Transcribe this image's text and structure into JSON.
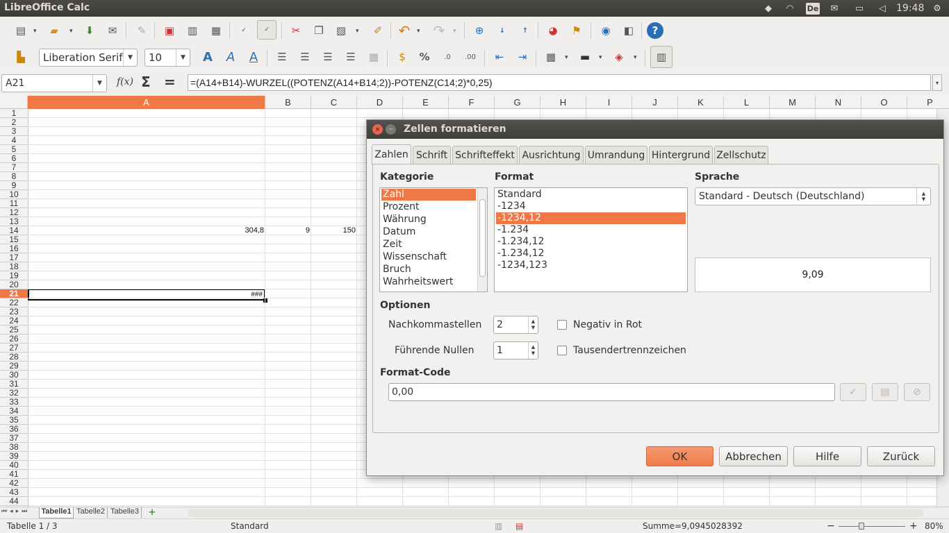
{
  "topbar": {
    "app_title": "LibreOffice Calc",
    "keyboard_layout": "De",
    "clock": "19:48"
  },
  "format_toolbar": {
    "font_name": "Liberation Serif",
    "font_size": "10"
  },
  "formula_bar": {
    "name_box": "A21",
    "fx": "f(x)",
    "sigma": "Σ",
    "equals": "=",
    "formula": "=(A14+B14)-WURZEL((POTENZ(A14+B14;2))-POTENZ(C14;2)*0,25)"
  },
  "sheet": {
    "columns": [
      "A",
      "B",
      "C",
      "D",
      "E",
      "F",
      "G",
      "H",
      "I",
      "J",
      "K",
      "L",
      "M",
      "N",
      "O",
      "P"
    ],
    "rows": [
      "1",
      "2",
      "3",
      "4",
      "5",
      "6",
      "7",
      "8",
      "9",
      "10",
      "11",
      "12",
      "13",
      "14",
      "15",
      "16",
      "17",
      "18",
      "19",
      "20",
      "21",
      "22",
      "23",
      "24",
      "25",
      "26",
      "27",
      "28",
      "29",
      "30",
      "31",
      "32",
      "33",
      "34",
      "35",
      "36",
      "37",
      "38",
      "39",
      "40",
      "41",
      "42",
      "43",
      "44"
    ],
    "cells": {
      "A14": "304,8",
      "B14": "9",
      "C14": "150",
      "A21": "###"
    },
    "selected_cell": "A21"
  },
  "sheet_tabs": [
    "Tabelle1",
    "Tabelle2",
    "Tabelle3"
  ],
  "statusbar": {
    "sheet_info": "Tabelle 1 / 3",
    "page_style": "Standard",
    "sum": "Summe=9,0945028392",
    "zoom": "80%"
  },
  "dialog": {
    "title": "Zellen formatieren",
    "tabs": [
      "Zahlen",
      "Schrift",
      "Schrifteffekt",
      "Ausrichtung",
      "Umrandung",
      "Hintergrund",
      "Zellschutz"
    ],
    "active_tab": "Zahlen",
    "category_label": "Kategorie",
    "categories": [
      "Zahl",
      "Prozent",
      "Währung",
      "Datum",
      "Zeit",
      "Wissenschaft",
      "Bruch",
      "Wahrheitswert"
    ],
    "selected_category": "Zahl",
    "format_label": "Format",
    "formats": [
      "Standard",
      "-1234",
      "-1234,12",
      "-1.234",
      "-1.234,12",
      "-1.234,12",
      "-1234,123"
    ],
    "selected_format": "-1234,12",
    "language_label": "Sprache",
    "language_value": "Standard - Deutsch (Deutschland)",
    "preview": "9,09",
    "options_label": "Optionen",
    "decimals_label": "Nachkommastellen",
    "decimals_value": "2",
    "leading_zeros_label": "Führende Nullen",
    "leading_zeros_value": "1",
    "negative_red_label": "Negativ in Rot",
    "thousands_sep_label": "Tausendertrennzeichen",
    "format_code_label": "Format-Code",
    "format_code_value": "0,00",
    "buttons": {
      "ok": "OK",
      "cancel": "Abbrechen",
      "help": "Hilfe",
      "reset": "Zurück"
    }
  },
  "colors": {
    "accent": "#f07746",
    "title_bar": "#3c3b37"
  }
}
